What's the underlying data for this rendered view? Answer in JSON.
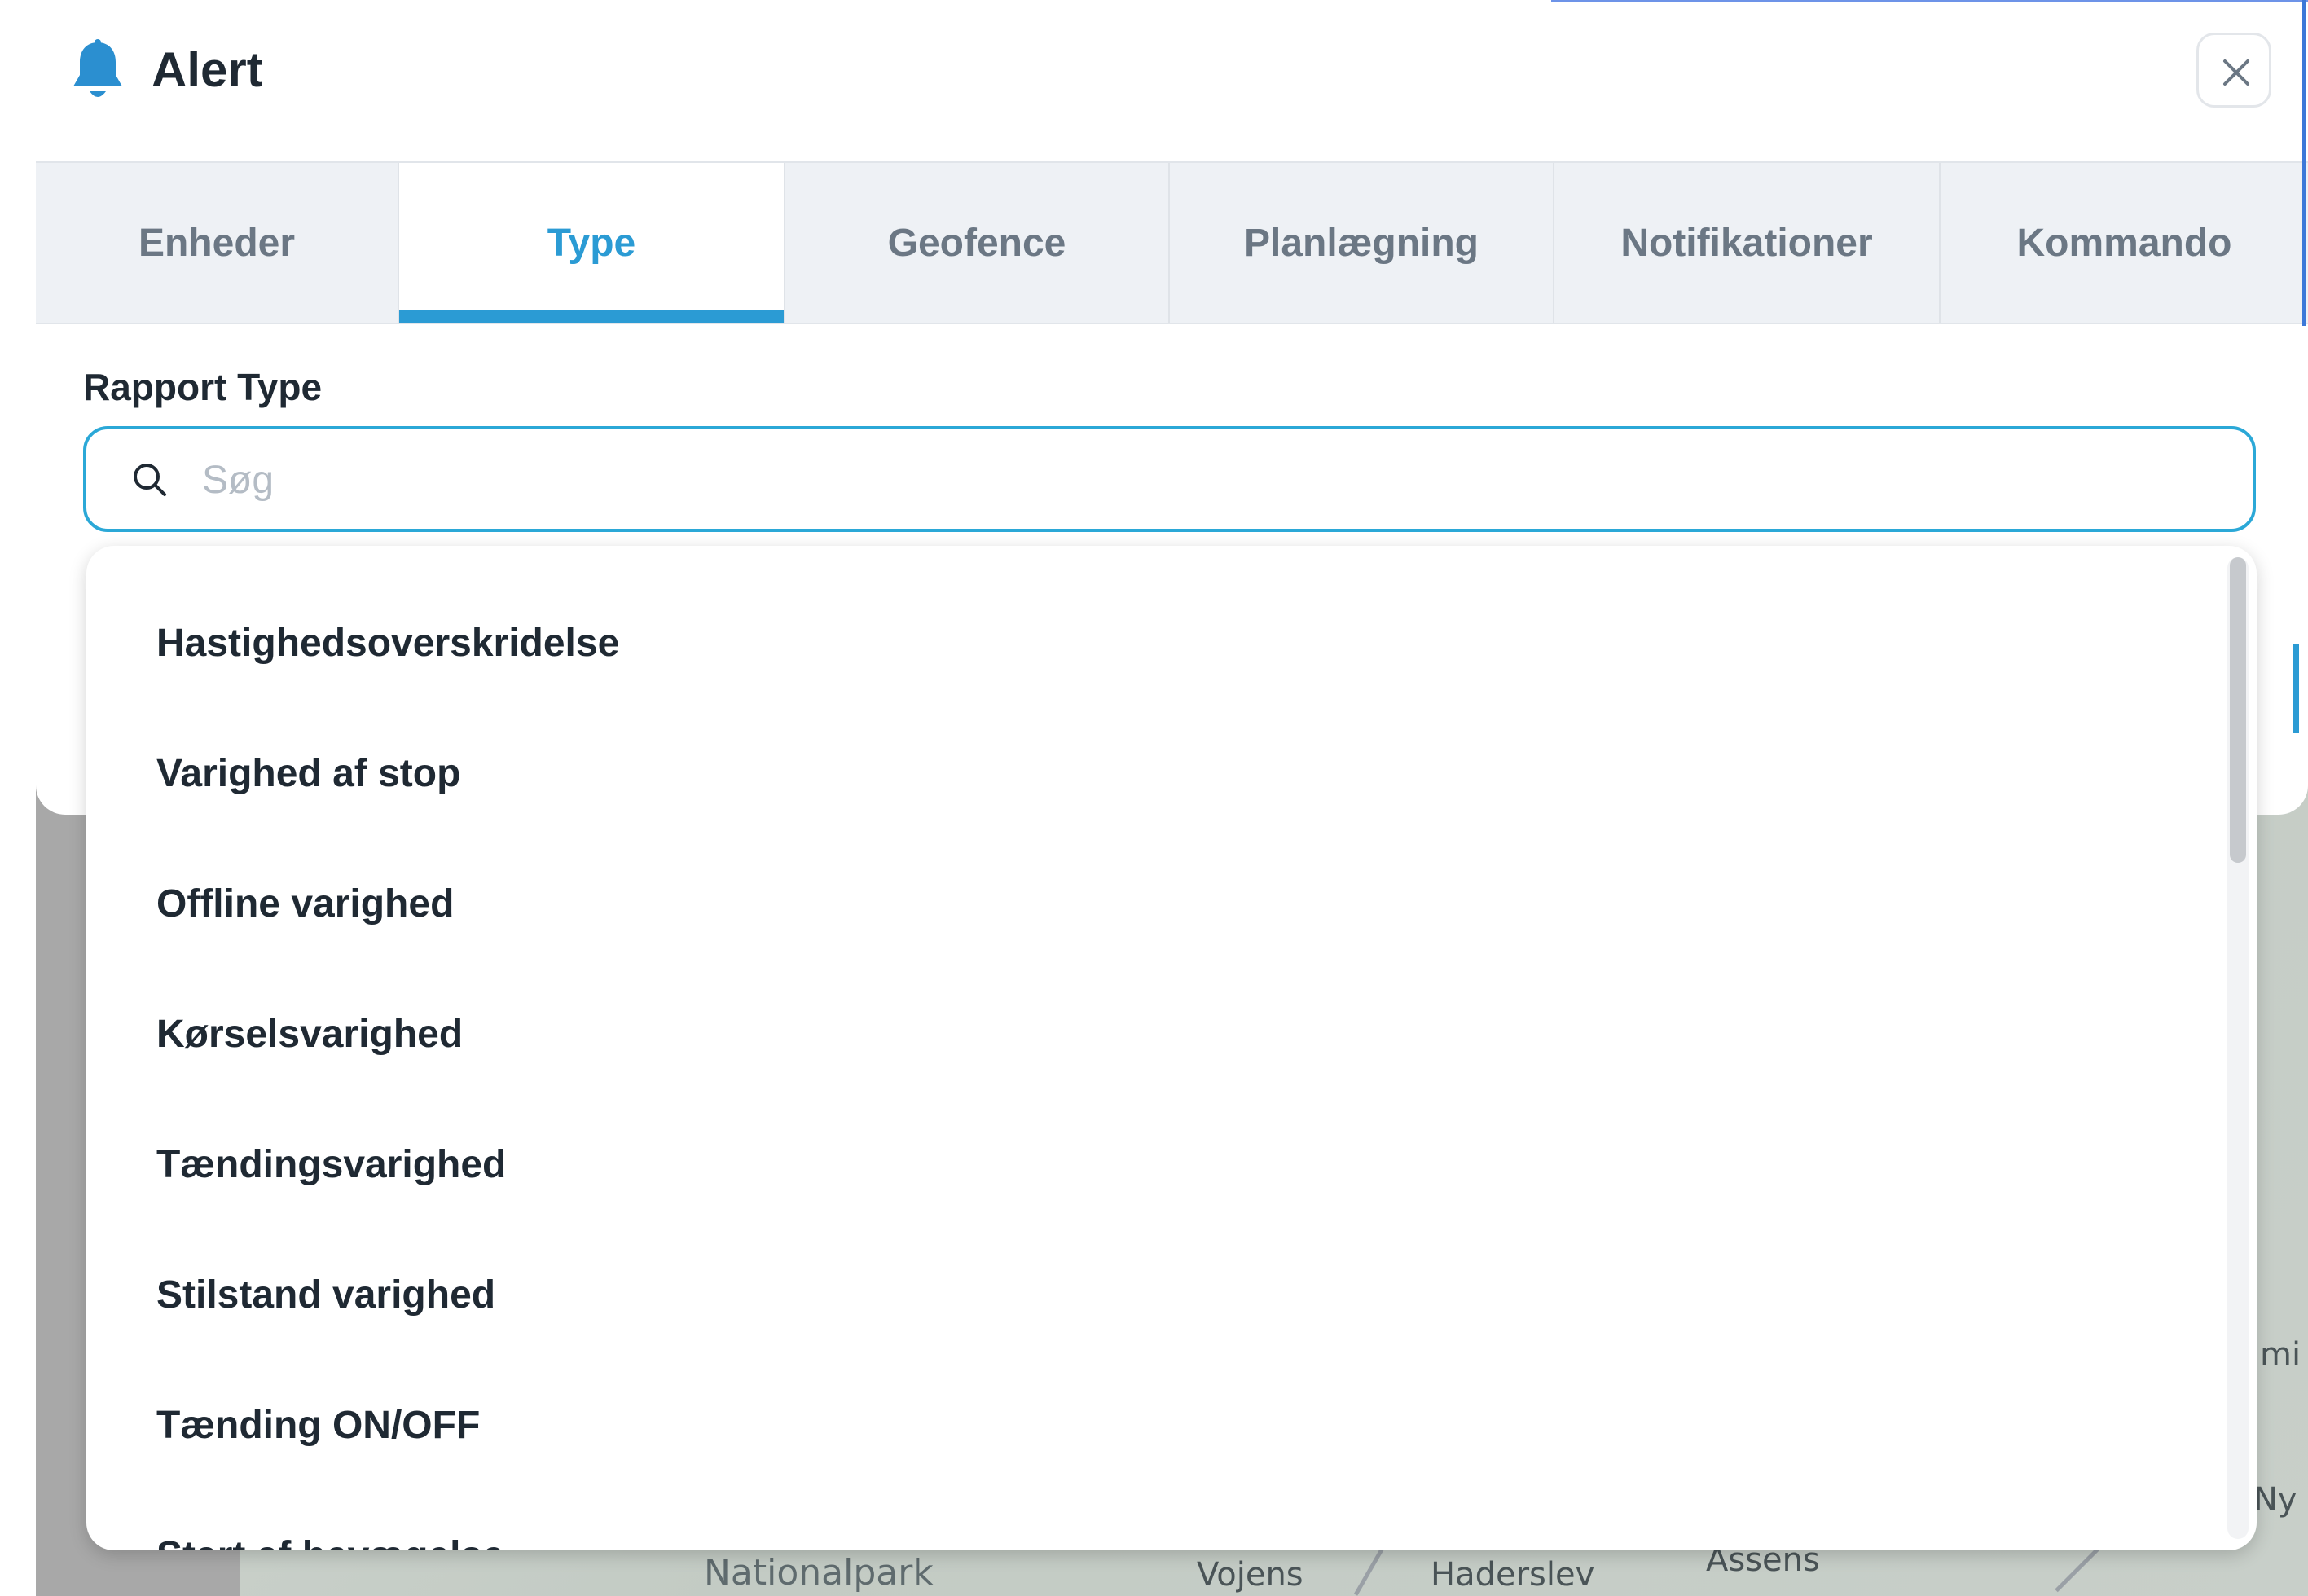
{
  "dialog": {
    "title": "Alert",
    "close_icon": "close-icon"
  },
  "tabs": [
    {
      "label": "Enheder",
      "active": false
    },
    {
      "label": "Type",
      "active": true
    },
    {
      "label": "Geofence",
      "active": false
    },
    {
      "label": "Planlægning",
      "active": false
    },
    {
      "label": "Notifikationer",
      "active": false
    },
    {
      "label": "Kommando",
      "active": false
    }
  ],
  "report_type": {
    "label": "Rapport Type",
    "search_placeholder": "Søg",
    "search_value": "",
    "options": [
      "Hastighedsoverskridelse",
      "Varighed af stop",
      "Offline varighed",
      "Kørselsvarighed",
      "Tændingsvarighed",
      "Stilstand varighed",
      "Tænding ON/OFF",
      "Start af bevægelse"
    ]
  },
  "map": {
    "labels": [
      "Nationalpark",
      "Vojens",
      "Haderslev",
      "Assens",
      "mi",
      "Ny"
    ]
  },
  "colors": {
    "accent": "#2b9bd4",
    "tab_bar_bg": "#eef1f5",
    "bell": "#2b8fd0"
  }
}
